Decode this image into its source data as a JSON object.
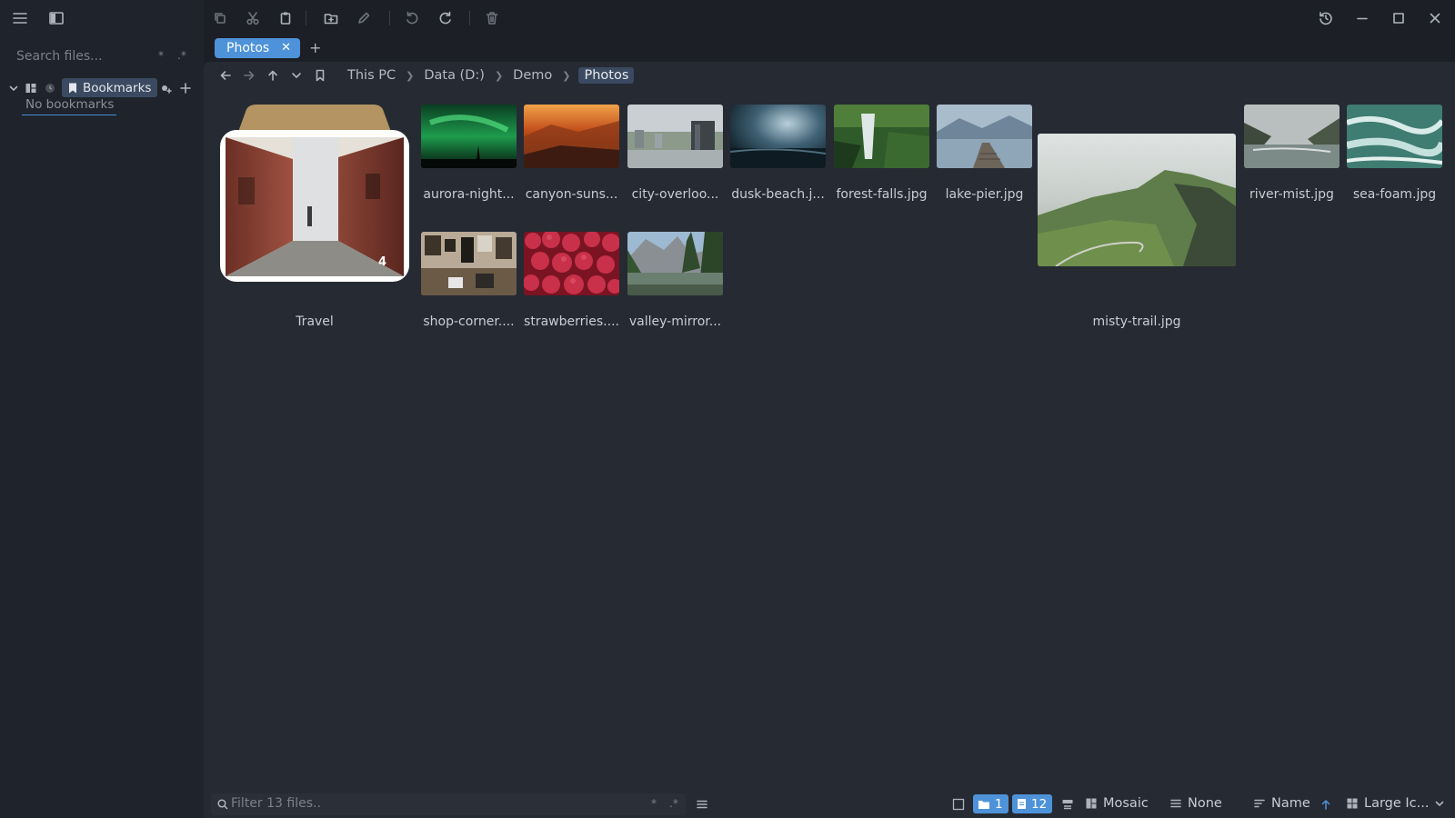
{
  "sidebar": {
    "search_placeholder": "Search files...",
    "search_mod1": "*",
    "search_mod2": ".*",
    "bookmarks_label": "Bookmarks",
    "empty_text": "No bookmarks"
  },
  "tabs": [
    {
      "label": "Photos"
    }
  ],
  "breadcrumb": [
    "This PC",
    "Data (D:)",
    "Demo",
    "Photos"
  ],
  "items": {
    "folder": {
      "label": "Travel",
      "count": "4"
    },
    "files": [
      {
        "label": "aurora-night..."
      },
      {
        "label": "canyon-suns..."
      },
      {
        "label": "city-overloo..."
      },
      {
        "label": "dusk-beach.j..."
      },
      {
        "label": "forest-falls.jpg"
      },
      {
        "label": "lake-pier.jpg"
      },
      {
        "label": "misty-trail.jpg"
      },
      {
        "label": "river-mist.jpg"
      },
      {
        "label": "sea-foam.jpg"
      },
      {
        "label": "shop-corner...."
      },
      {
        "label": "strawberries...."
      },
      {
        "label": "valley-mirror..."
      }
    ]
  },
  "statusbar": {
    "filter_placeholder": "Filter 13 files..",
    "filter_mod1": "*",
    "filter_mod2": ".*",
    "folder_count": "1",
    "file_count": "12",
    "layout": "Mosaic",
    "group": "None",
    "sort": "Name",
    "view": "Large Ic..."
  },
  "colors": {
    "accent": "#4e93d9",
    "chip": "#3b4a60",
    "background": "#262a33"
  }
}
